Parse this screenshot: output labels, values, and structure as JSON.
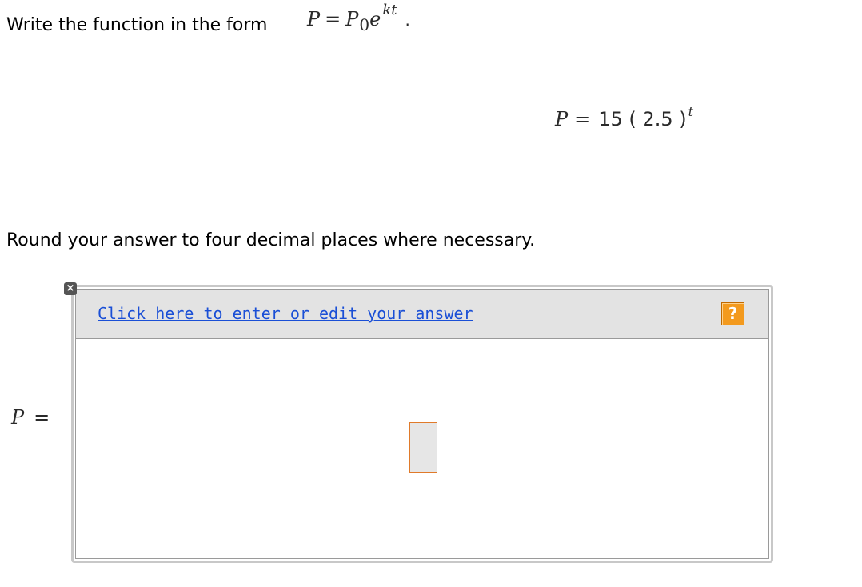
{
  "instruction": {
    "text": "Write the function in the form",
    "formula": {
      "lhs": "P",
      "eq": "=",
      "base": "P",
      "subscript": "0",
      "e": "e",
      "exponent": "kt",
      "period": "."
    }
  },
  "given": {
    "lhs": "P",
    "eq": "=",
    "expression": "15 ( 2.5 )",
    "exponent": "t"
  },
  "round_instruction": "Round your answer to four decimal places where necessary.",
  "answer": {
    "close_glyph": "×",
    "edit_link": "Click here to enter or edit your answer",
    "help_label": "?",
    "lhs": "P",
    "eq": "=",
    "input_value": ""
  }
}
